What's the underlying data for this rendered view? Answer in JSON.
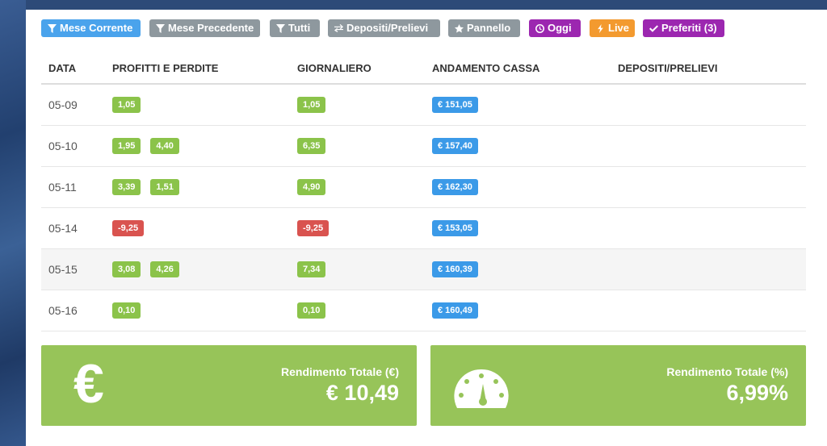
{
  "toolbar": {
    "buttons": [
      {
        "label": "Mese Corrente",
        "icon": "filter-icon",
        "color": "#4aa3ec"
      },
      {
        "label": "Mese Precedente",
        "icon": "filter-icon",
        "color": "#8e989e"
      },
      {
        "label": "Tutti",
        "icon": "filter-icon",
        "color": "#8e989e"
      },
      {
        "label": "Depositi/Prelievi",
        "icon": "exchange-icon",
        "color": "#8e989e"
      },
      {
        "label": "Pannello",
        "icon": "star-icon",
        "color": "#8e989e"
      },
      {
        "label": "Oggi",
        "icon": "clock-icon",
        "color": "#9c27b0"
      },
      {
        "label": "Live",
        "icon": "bolt-icon",
        "color": "#f39a2f"
      },
      {
        "label": "Preferiti (3)",
        "icon": "check-icon",
        "color": "#9c27b0"
      }
    ]
  },
  "table": {
    "headers": [
      "DATA",
      "PROFITTI E PERDITE",
      "GIORNALIERO",
      "ANDAMENTO CASSA",
      "DEPOSITI/PRELIEVI"
    ],
    "rows": [
      {
        "date": "05-09",
        "pl": [
          "1,05"
        ],
        "daily": "1,05",
        "cash": "€ 151,05"
      },
      {
        "date": "05-10",
        "pl": [
          "1,95",
          "4,40"
        ],
        "daily": "6,35",
        "cash": "€ 157,40"
      },
      {
        "date": "05-11",
        "pl": [
          "3,39",
          "1,51"
        ],
        "daily": "4,90",
        "cash": "€ 162,30"
      },
      {
        "date": "05-14",
        "pl": [
          "-9,25"
        ],
        "daily": "-9,25",
        "cash": "€ 153,05"
      },
      {
        "date": "05-15",
        "pl": [
          "3,08",
          "4,26"
        ],
        "daily": "7,34",
        "cash": "€ 160,39"
      },
      {
        "date": "05-16",
        "pl": [
          "0,10"
        ],
        "daily": "0,10",
        "cash": "€ 160,49"
      }
    ]
  },
  "summary": {
    "total_eur": {
      "label": "Rendimento Totale (€)",
      "value": "€ 10,49",
      "icon": "euro-icon"
    },
    "total_pct": {
      "label": "Rendimento Totale (%)",
      "value": "6,99%",
      "icon": "dashboard-gauge-icon"
    }
  },
  "colors": {
    "positive": "#8bc34a",
    "negative": "#d9534f",
    "cash": "#3b9ae8",
    "tile": "#97c459"
  }
}
